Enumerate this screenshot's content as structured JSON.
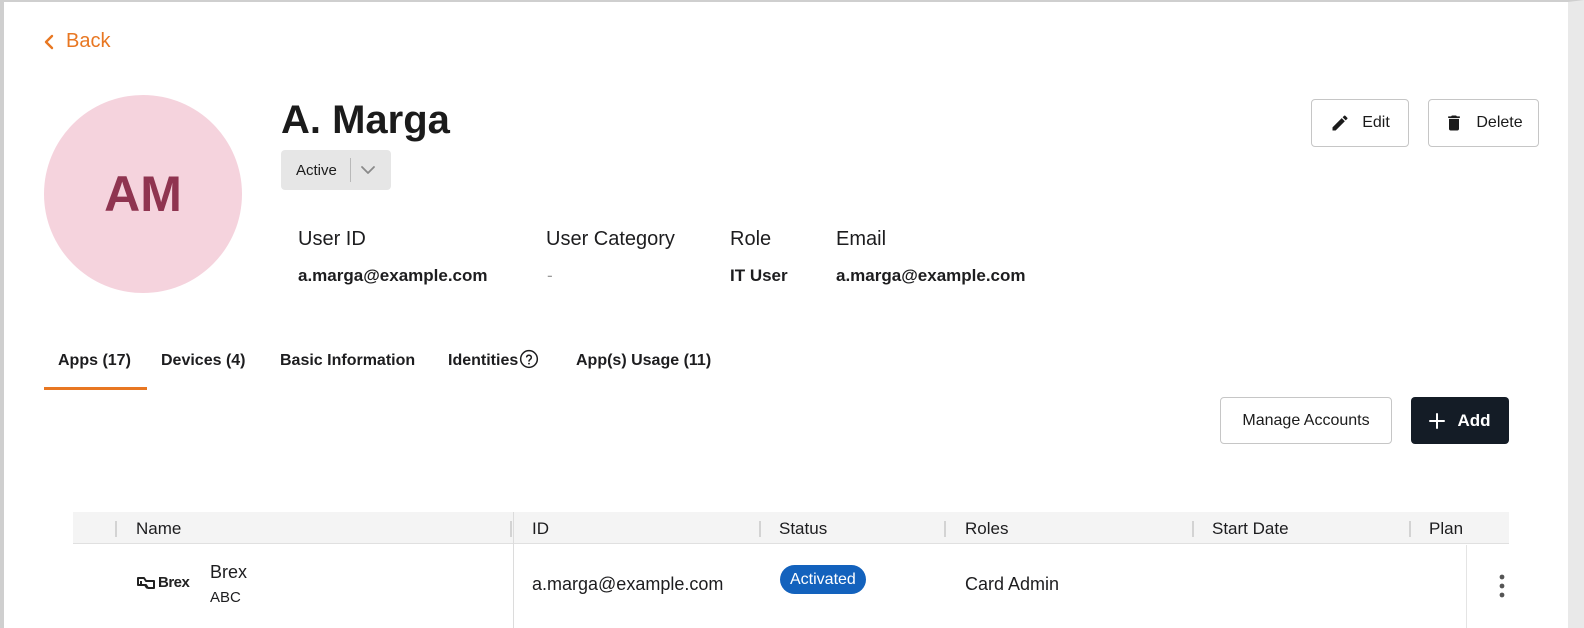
{
  "nav": {
    "back_label": "Back"
  },
  "profile": {
    "initials": "AM",
    "name": "A. Marga",
    "status": "Active",
    "colors": {
      "avatar_bg": "#f5d3dd",
      "avatar_text": "#8f3450",
      "accent": "#e87722"
    }
  },
  "actions": {
    "edit_label": "Edit",
    "delete_label": "Delete"
  },
  "details": [
    {
      "label": "User ID",
      "value": "a.marga@example.com"
    },
    {
      "label": "User Category",
      "value": "-"
    },
    {
      "label": "Role",
      "value": "IT User"
    },
    {
      "label": "Email",
      "value": "a.marga@example.com"
    }
  ],
  "tabs": [
    {
      "label": "Apps (17)",
      "active": true
    },
    {
      "label": "Devices (4)"
    },
    {
      "label": "Basic Information"
    },
    {
      "label": "Identities",
      "icon": "help-circle-icon"
    },
    {
      "label": "App(s) Usage (11)"
    }
  ],
  "toolbar": {
    "manage_label": "Manage Accounts",
    "add_label": "Add"
  },
  "table": {
    "columns": [
      "Name",
      "ID",
      "Status",
      "Roles",
      "Start Date",
      "Plan"
    ],
    "rows": [
      {
        "logo_text": "Brex",
        "name": "Brex",
        "subtitle": "ABC",
        "id": "a.marga@example.com",
        "status": "Activated",
        "roles": "Card Admin",
        "start_date": "",
        "plan": ""
      }
    ],
    "status_color": "#1362bd"
  }
}
